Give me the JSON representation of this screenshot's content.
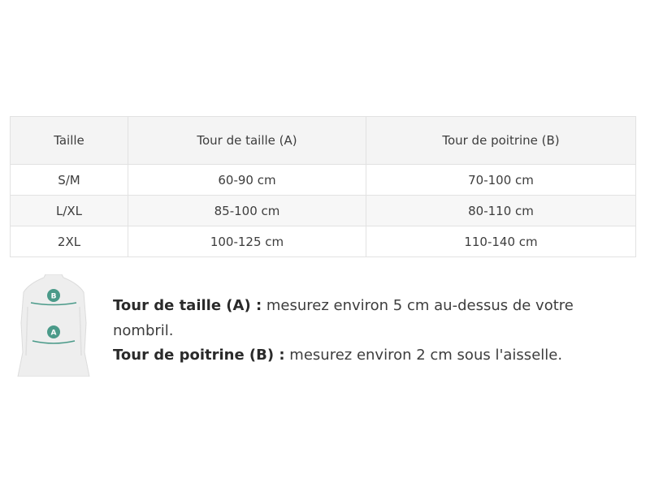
{
  "table": {
    "headers": [
      "Taille",
      "Tour de taille (A)",
      "Tour de poitrine (B)"
    ],
    "rows": [
      [
        "S/M",
        "60-90 cm",
        "70-100 cm"
      ],
      [
        "L/XL",
        "85-100 cm",
        "80-110 cm"
      ],
      [
        "2XL",
        "100-125 cm",
        "110-140 cm"
      ]
    ]
  },
  "figure": {
    "marker_b": "B",
    "marker_a": "A",
    "accent_color": "#4a9a89"
  },
  "instructions": {
    "waist_term": "Tour de taille (A) :",
    "waist_text": " mesurez environ 5 cm au-dessus de votre nombril.",
    "chest_term": "Tour de poitrine (B) :",
    "chest_text": " mesurez environ 2 cm sous l'aisselle."
  }
}
